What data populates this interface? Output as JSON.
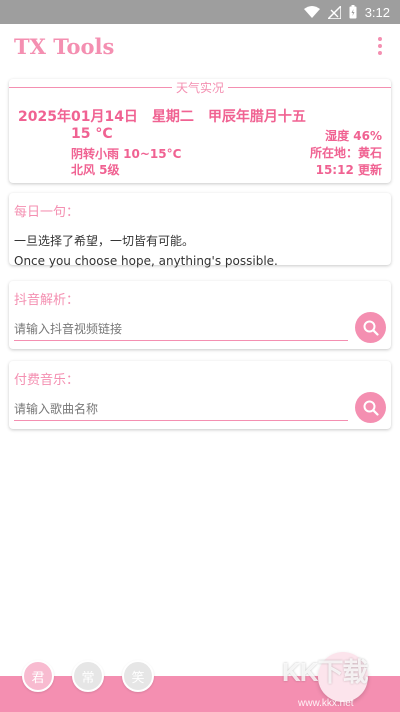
{
  "status_bar": {
    "time": "3:12"
  },
  "app": {
    "title": "TX Tools"
  },
  "weather": {
    "legend": "天气实况",
    "date": "2025年01月14日",
    "weekday": "星期二",
    "lunar": "甲辰年腊月十五",
    "temperature": "15 °C",
    "condition": "阴转小雨 10~15°C",
    "wind": "北风 5级",
    "humidity": "湿度 46%",
    "location": "所在地：黄石",
    "updated": "15:12 更新"
  },
  "quote": {
    "label": "每日一句：",
    "zh": "一旦选择了希望，一切皆有可能。",
    "en": "Once you choose hope, anything's possible."
  },
  "douyin": {
    "label": "抖音解析：",
    "placeholder": "请输入抖音视频链接"
  },
  "music": {
    "label": "付费音乐：",
    "placeholder": "请输入歌曲名称"
  },
  "bottom": {
    "b1": "君",
    "b2": "常",
    "b3": "笑"
  },
  "watermark": {
    "logo": "KK下载",
    "url": "www.kkx.net"
  },
  "colors": {
    "accent": "#f48fb1",
    "accent_dark": "#f06292",
    "status_bar": "#9e9e9e"
  }
}
